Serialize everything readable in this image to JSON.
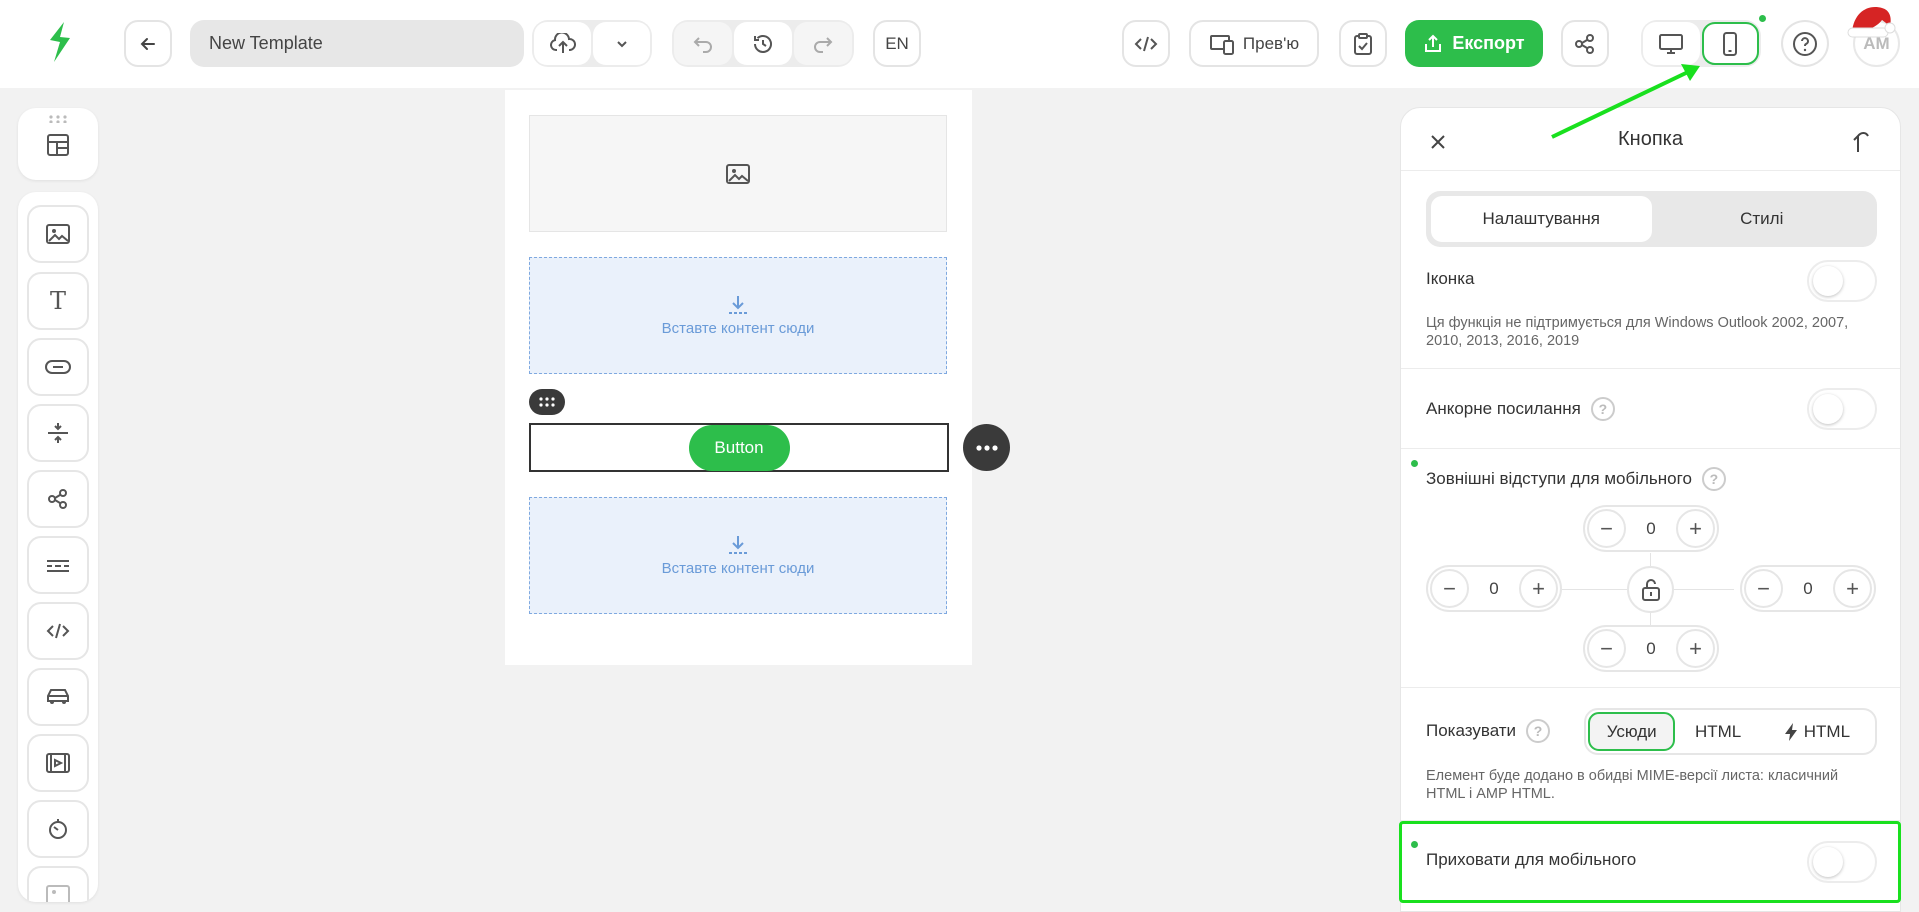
{
  "topbar": {
    "template_name": "New Template",
    "language": "EN",
    "preview_label": "Прев'ю",
    "export_label": "Експорт",
    "avatar_initials": "AM"
  },
  "canvas": {
    "drop_zone_text": "Вставте контент сюди",
    "button_text": "Button"
  },
  "panel": {
    "title": "Кнопка",
    "tabs": [
      "Налаштування",
      "Стилі"
    ],
    "icon_label": "Іконка",
    "icon_hint": "Ця функція не підтримується для Windows Outlook 2002, 2007, 2010, 2013, 2016, 2019",
    "anchor_label": "Анкорне посилання",
    "margins_label": "Зовнішні відступи для мобільного",
    "margin_top": "0",
    "margin_left": "0",
    "margin_right": "0",
    "margin_bottom": "0",
    "show_label": "Показувати",
    "show_options": [
      "Усюди",
      "HTML",
      "HTML"
    ],
    "show_hint": "Елемент буде додано в обидві MIME-версії листа: класичний HTML і AMP HTML.",
    "hide_mobile_label": "Приховати для мобільного",
    "help_glyph": "?"
  },
  "colors": {
    "accent": "#2dbe4b",
    "highlight": "#19e01e"
  }
}
